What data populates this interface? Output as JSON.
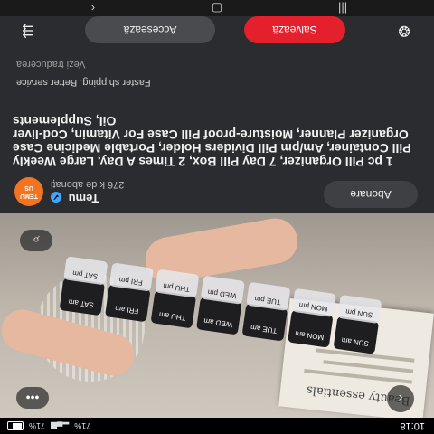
{
  "status_bar": {
    "time": "10:18",
    "battery": "71%",
    "network": "71%"
  },
  "media": {
    "book_title": "Beauty essentials",
    "compartments_bottom": [
      "SUN am",
      "MON am",
      "TUE am",
      "WED am",
      "THU am",
      "FRI am",
      "SAT am"
    ],
    "compartments_top": [
      "SUN pm",
      "MON pm",
      "TUE pm",
      "WED pm",
      "THU pm",
      "FRI pm",
      "SAT pm"
    ],
    "back_icon": "chevron-left-icon",
    "more_icon": "more-dots-icon",
    "lens_icon": "lens-search-icon"
  },
  "channel": {
    "logo_text": "TEMU",
    "logo_subtext": "US",
    "name": "Temu",
    "subscribers": "276 k de abonați",
    "subscribe_label": "Abonare",
    "verified_icon": "verified-check-icon"
  },
  "video": {
    "title": "1 pc Pill Organizer, 7 Day Pill Box, 2 Times A Day, Large Weekly Pill Container, Am/pm Pill Dividers Holder, Portable Medicine Case Organizer Planner, Moisture-proof Pill Case For Vitamin, Cod-liver Oil, Supplements",
    "subtitle": "Faster shipping. Better service",
    "see_translation": "Vezi traducerea"
  },
  "actions": {
    "save_label": "Salvează",
    "access_label": "Accesează",
    "share_icon": "share-icon",
    "remix_icon": "remix-icon"
  },
  "colors": {
    "save_red": "#e4202d",
    "background": "#2b2c2f",
    "temu_orange": "#f27420"
  }
}
